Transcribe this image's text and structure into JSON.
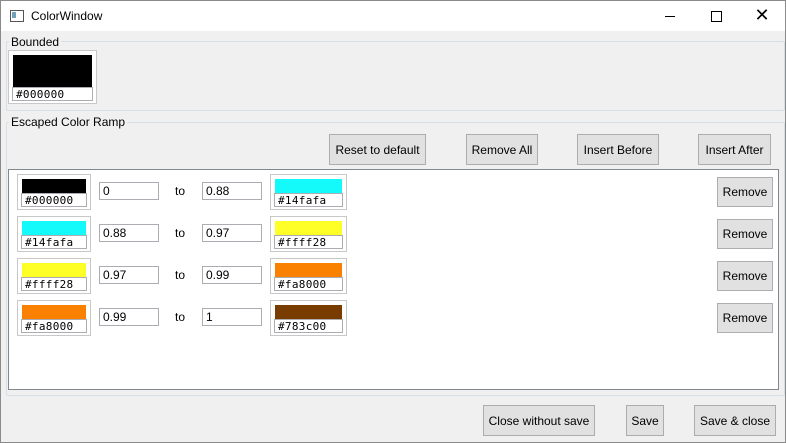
{
  "window": {
    "title": "ColorWindow"
  },
  "bounded": {
    "label": "Bounded",
    "swatch": {
      "hex": "#000000",
      "color": "#000000"
    }
  },
  "ramp": {
    "label": "Escaped Color Ramp",
    "buttons": {
      "reset": "Reset to default",
      "remove_all": "Remove All",
      "insert_before": "Insert Before",
      "insert_after": "Insert After"
    },
    "to_label": "to",
    "remove_label": "Remove",
    "rows": [
      {
        "from_hex": "#000000",
        "from_color": "#000000",
        "start": "0",
        "end": "0.88",
        "to_hex": "#14fafa",
        "to_color": "#14fafa"
      },
      {
        "from_hex": "#14fafa",
        "from_color": "#14fafa",
        "start": "0.88",
        "end": "0.97",
        "to_hex": "#ffff28",
        "to_color": "#ffff28"
      },
      {
        "from_hex": "#ffff28",
        "from_color": "#ffff28",
        "start": "0.97",
        "end": "0.99",
        "to_hex": "#fa8000",
        "to_color": "#fa8000"
      },
      {
        "from_hex": "#fa8000",
        "from_color": "#fa8000",
        "start": "0.99",
        "end": "1",
        "to_hex": "#783c00",
        "to_color": "#783c00"
      }
    ]
  },
  "footer": {
    "close_without_save": "Close without save",
    "save": "Save",
    "save_close": "Save & close"
  }
}
